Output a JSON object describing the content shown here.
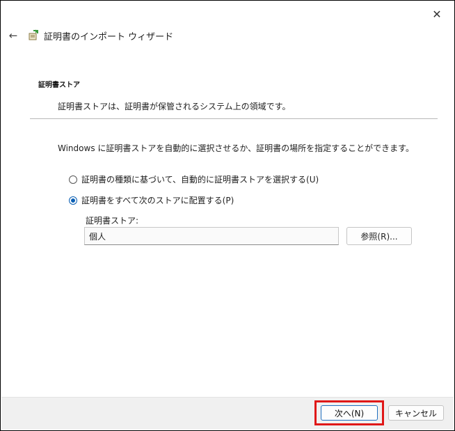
{
  "window": {
    "close_glyph": "✕",
    "back_glyph": "←",
    "title": "証明書のインポート ウィザード",
    "title_icon": "certificate-wizard-icon"
  },
  "section": {
    "title": "証明書ストア",
    "description": "証明書ストアは、証明書が保管されるシステム上の領域です。"
  },
  "main": {
    "instruction": "Windows に証明書ストアを自動的に選択させるか、証明書の場所を指定することができます。",
    "options": [
      {
        "label": "証明書の種類に基づいて、自動的に証明書ストアを選択する(U)",
        "checked": false
      },
      {
        "label": "証明書をすべて次のストアに配置する(P)",
        "checked": true
      }
    ],
    "store_label": "証明書ストア:",
    "store_value": "個人",
    "browse_label": "参照(R)..."
  },
  "footer": {
    "next_label": "次へ(N)",
    "cancel_label": "キャンセル",
    "highlight_color": "#e01818"
  }
}
